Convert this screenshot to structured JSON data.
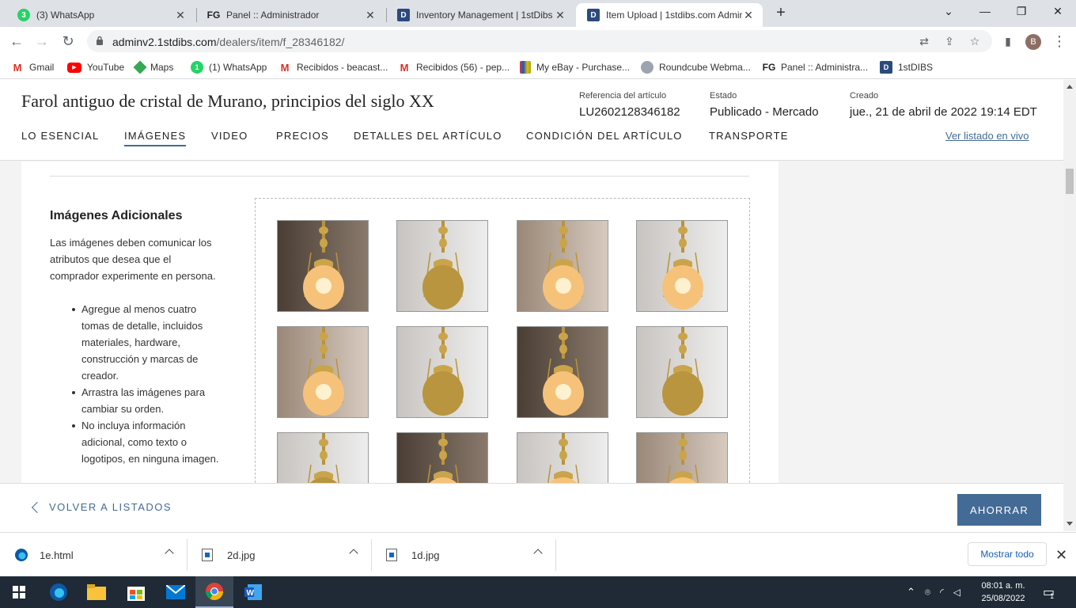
{
  "browser": {
    "tabs": [
      {
        "title": "(3) WhatsApp",
        "icon": "whatsapp-icon",
        "active": false
      },
      {
        "title": "Panel :: Administrador",
        "icon": "fg-logo-icon",
        "active": false
      },
      {
        "title": "Inventory Management | 1stDibs",
        "icon": "1stdibs-icon",
        "active": false
      },
      {
        "title": "Item Upload | 1stdibs.com Admin",
        "icon": "1stdibs-icon",
        "active": true
      }
    ],
    "url_host": "adminv2.1stdibs.com",
    "url_path": "/dealers/item/f_28346182/",
    "profile_initial": "B",
    "bookmarks": [
      {
        "label": "Gmail",
        "icon": "gmail-icon"
      },
      {
        "label": "YouTube",
        "icon": "youtube-icon"
      },
      {
        "label": "Maps",
        "icon": "maps-icon"
      },
      {
        "label": "(1) WhatsApp",
        "icon": "whatsapp-icon"
      },
      {
        "label": "Recibidos - beacast...",
        "icon": "gmail-icon"
      },
      {
        "label": "Recibidos (56) - pep...",
        "icon": "gmail-icon"
      },
      {
        "label": "My eBay - Purchase...",
        "icon": "ebay-icon"
      },
      {
        "label": "Roundcube Webma...",
        "icon": "roundcube-icon"
      },
      {
        "label": "Panel :: Administra...",
        "icon": "fg-logo-icon"
      },
      {
        "label": "1stDIBS",
        "icon": "1stdibs-icon"
      }
    ]
  },
  "item": {
    "title": "Farol antiguo de cristal de Murano, principios del siglo XX",
    "ref_label": "Referencia del artículo",
    "ref_value": "LU2602128346182",
    "status_label": "Estado",
    "status_value": "Publicado - Mercado",
    "created_label": "Creado",
    "created_value": "jue., 21 de abril de 2022 19:14 EDT"
  },
  "nav": {
    "tabs": [
      "LO ESENCIAL",
      "IMÁGENES",
      "VIDEO",
      "PRECIOS",
      "DETALLES DEL ARTÍCULO",
      "CONDICIÓN DEL ARTÍCULO",
      "TRANSPORTE"
    ],
    "active_index": 1,
    "live_link": "Ver listado en vivo"
  },
  "images_section": {
    "title": "Imágenes Adicionales",
    "description": "Las imágenes deben comunicar los atributos que desea que el comprador experimente en persona.",
    "tips": [
      "Agregue al menos cuatro tomas de detalle, incluidos materiales, hardware, construcción y marcas de creador.",
      "Arrastra las imágenes para cambiar su orden.",
      "No incluya información adicional, como texto o logotipos, en ninguna imagen."
    ],
    "thumbnails": [
      {
        "tone": "dark",
        "lit": true
      },
      {
        "tone": "light",
        "lit": false
      },
      {
        "tone": "mid",
        "lit": true
      },
      {
        "tone": "light",
        "lit": true
      },
      {
        "tone": "mid",
        "lit": true
      },
      {
        "tone": "light",
        "lit": false
      },
      {
        "tone": "dark",
        "lit": true
      },
      {
        "tone": "light",
        "lit": false
      },
      {
        "tone": "light",
        "lit": false
      },
      {
        "tone": "dark",
        "lit": true
      },
      {
        "tone": "light",
        "lit": true
      },
      {
        "tone": "mid",
        "lit": true
      }
    ]
  },
  "footer": {
    "back_label": "VOLVER A LISTADOS",
    "save_label": "AHORRAR"
  },
  "downloads": {
    "items": [
      {
        "name": "1e.html",
        "icon": "edge-file-icon"
      },
      {
        "name": "2d.jpg",
        "icon": "image-file-icon"
      },
      {
        "name": "1d.jpg",
        "icon": "image-file-icon"
      }
    ],
    "show_all": "Mostrar todo"
  },
  "taskbar": {
    "apps": [
      "edge-icon",
      "file-explorer-icon",
      "store-icon",
      "mail-icon",
      "chrome-icon",
      "word-icon"
    ],
    "time": "08:01 a. m.",
    "date": "25/08/2022",
    "notifications": "1"
  },
  "colors": {
    "accent": "#436b95",
    "tabstrip": "#dee1e6",
    "taskbar": "#1f2a36"
  }
}
